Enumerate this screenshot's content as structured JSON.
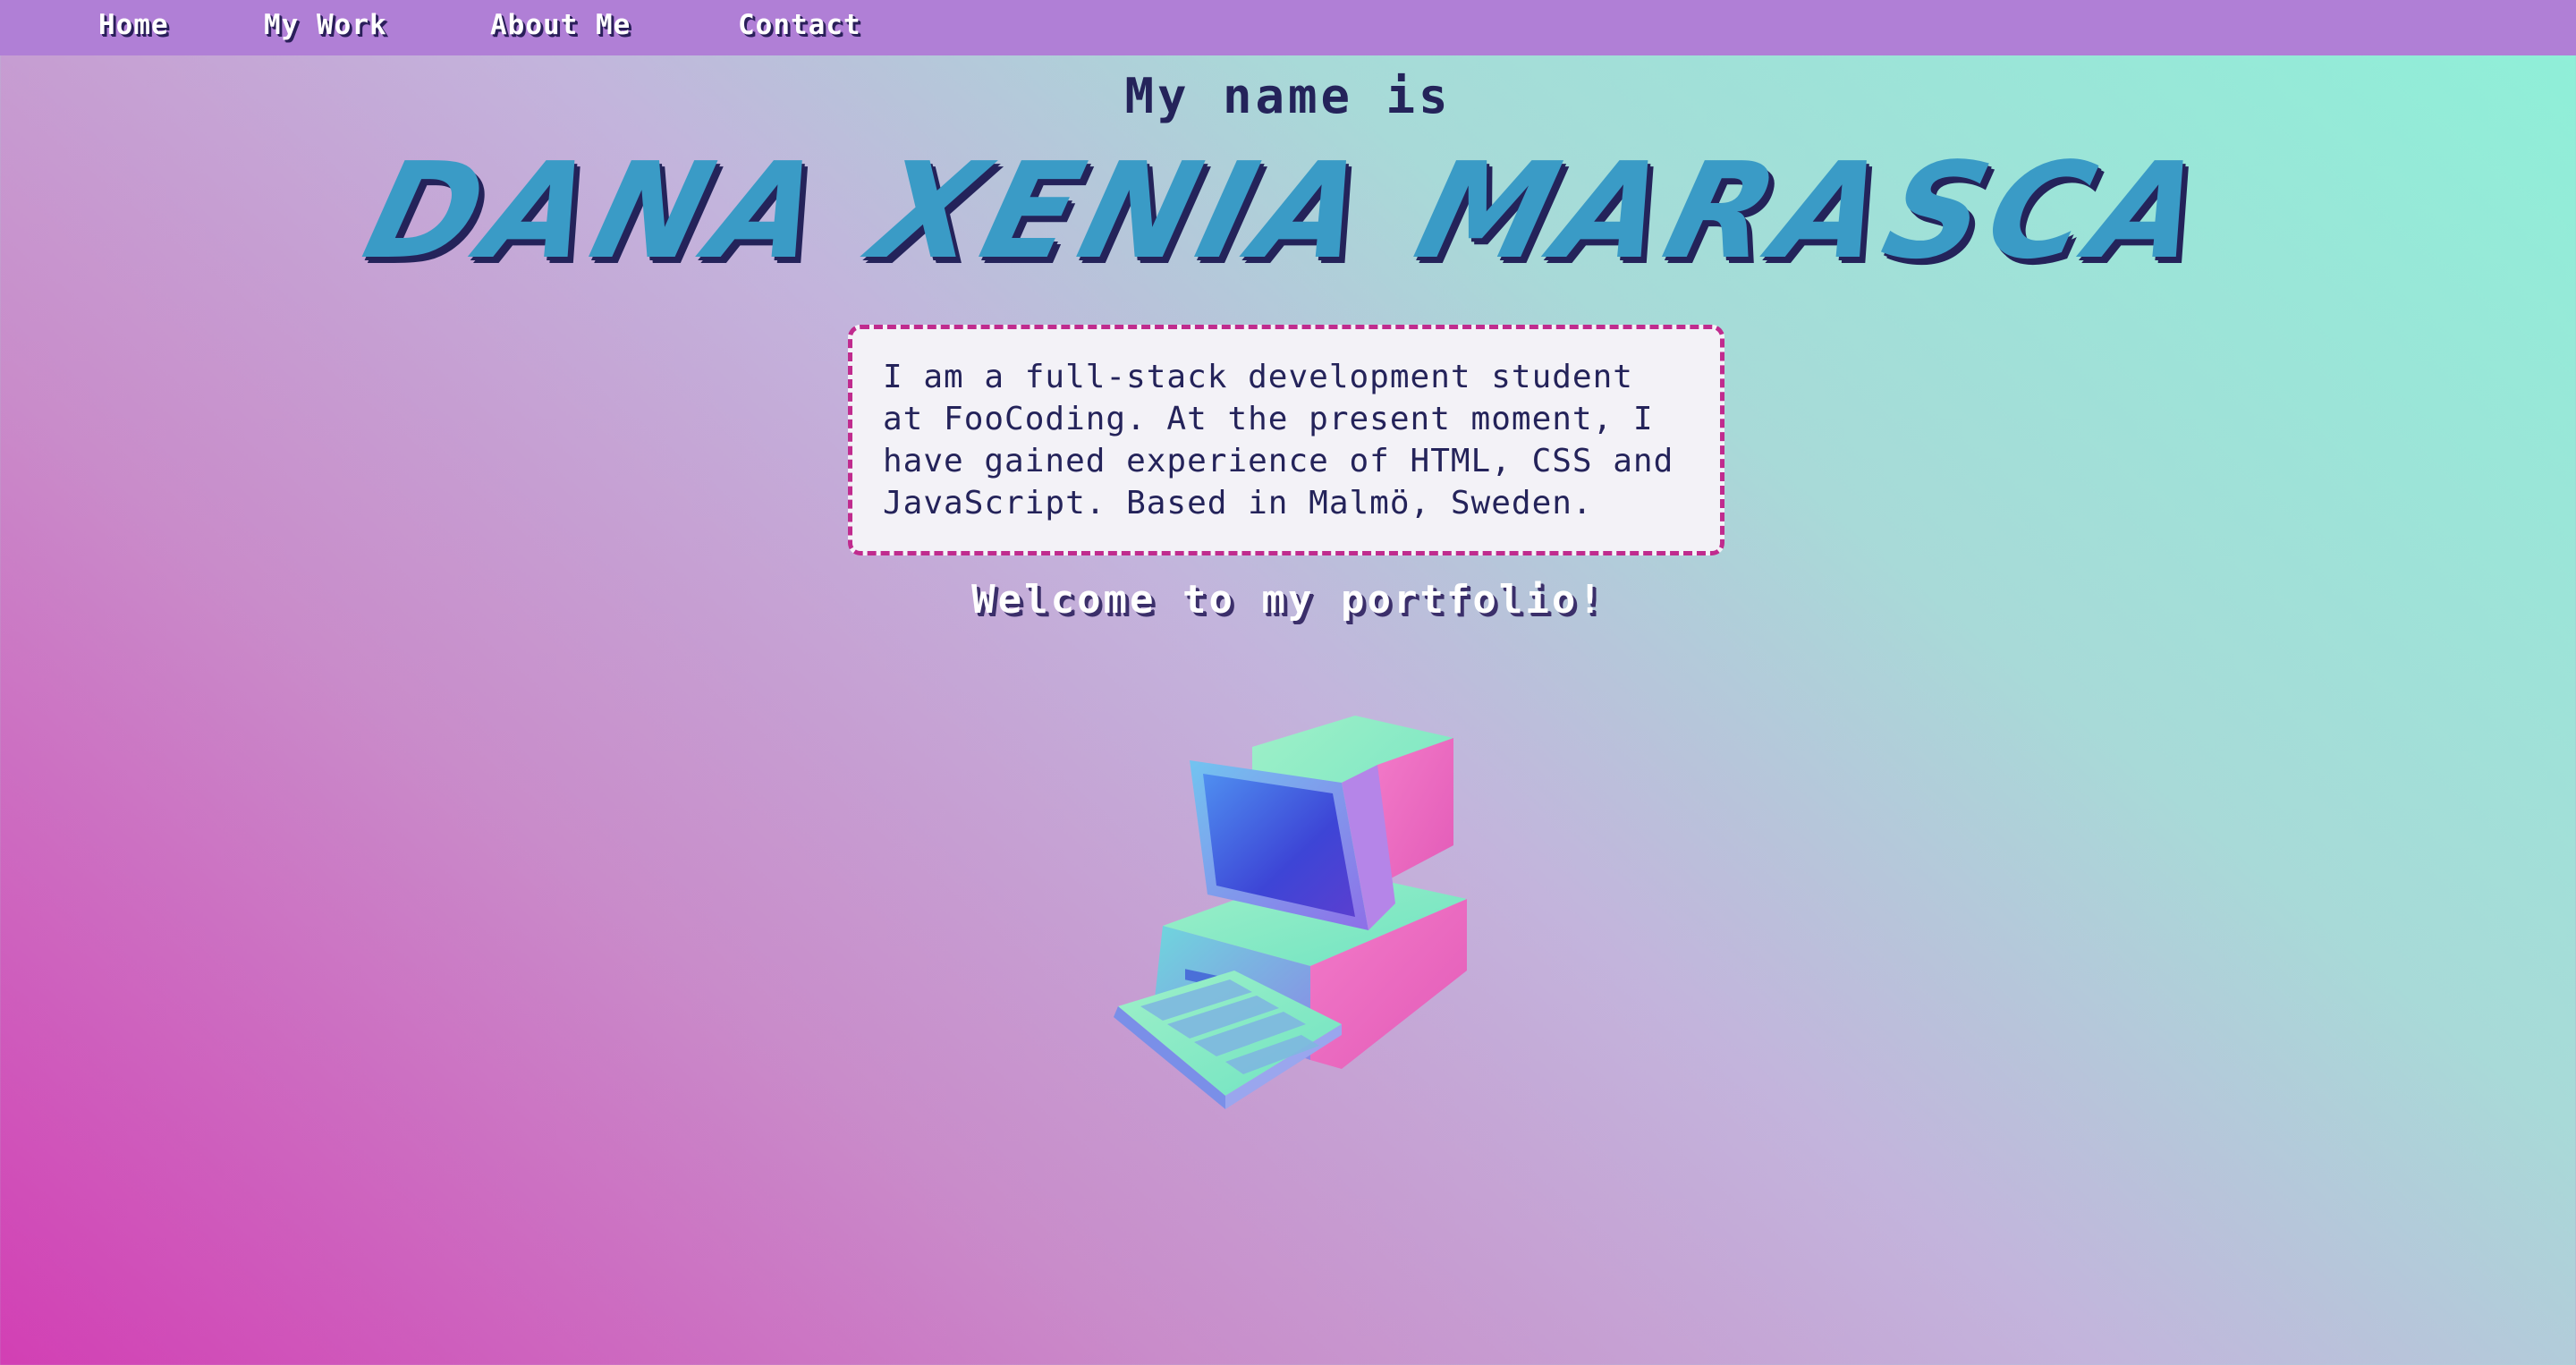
{
  "nav": {
    "items": [
      {
        "label": "Home"
      },
      {
        "label": "My Work"
      },
      {
        "label": "About Me"
      },
      {
        "label": "Contact"
      }
    ]
  },
  "hero": {
    "intro": "My name is",
    "name": "DANA XENIA MARASCA",
    "bio": "I am a full-stack development student at FooCoding. At the present moment, I have gained experience of HTML, CSS and JavaScript. Based in Malmö, Sweden.",
    "welcome": "Welcome to my portfolio!"
  },
  "colors": {
    "nav_background": "#b07fd6",
    "text_dark": "#24235a",
    "name_blue": "#3a9bc6",
    "box_border": "#c02b8e",
    "gradient_pink": "#d23fb4",
    "gradient_mint": "#8ef0d8"
  },
  "icons": {
    "computer": "retro-computer-icon"
  }
}
